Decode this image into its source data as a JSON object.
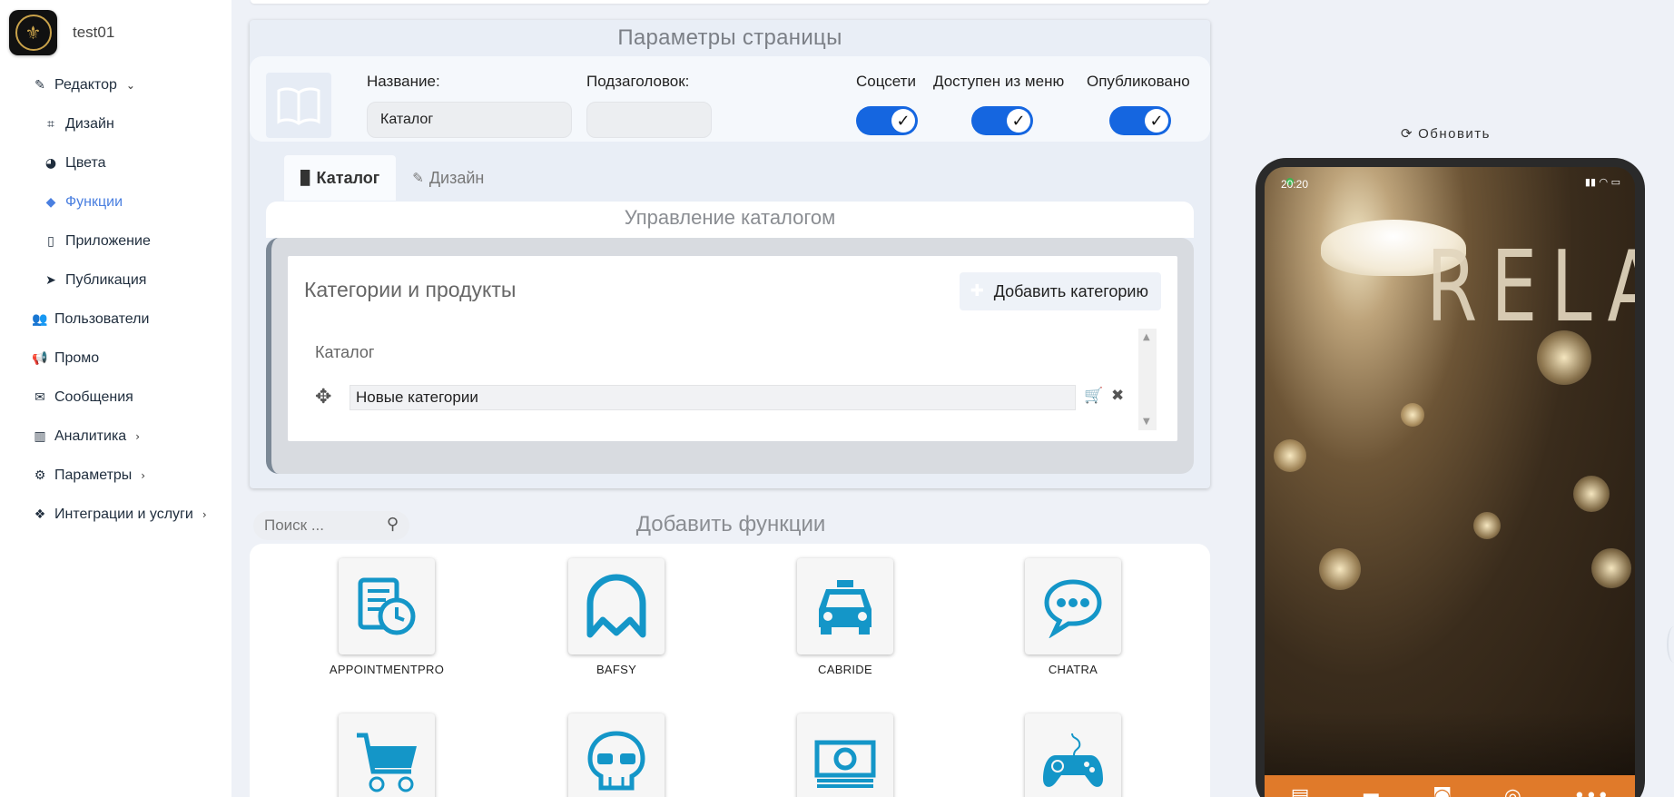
{
  "brand": {
    "name": "test01"
  },
  "sidebar": {
    "items": [
      {
        "label": "Редактор",
        "icon": "pencil-icon",
        "glyph": "✎",
        "chevron": "⌄"
      },
      {
        "label": "Дизайн",
        "icon": "crop-icon",
        "glyph": "⌗",
        "sub": true
      },
      {
        "label": "Цвета",
        "icon": "palette-icon",
        "glyph": "◕",
        "sub": true
      },
      {
        "label": "Функции",
        "icon": "cube-icon",
        "glyph": "◆",
        "sub": true,
        "active": true
      },
      {
        "label": "Приложение",
        "icon": "mobile-icon",
        "glyph": "▯",
        "sub": true
      },
      {
        "label": "Публикация",
        "icon": "paper-plane-icon",
        "glyph": "➤",
        "sub": true
      },
      {
        "label": "Пользователи",
        "icon": "users-icon",
        "glyph": "👥"
      },
      {
        "label": "Промо",
        "icon": "bullhorn-icon",
        "glyph": "📢"
      },
      {
        "label": "Сообщения",
        "icon": "envelope-icon",
        "glyph": "✉"
      },
      {
        "label": "Аналитика",
        "icon": "chart-icon",
        "glyph": "▥",
        "chevron": "›"
      },
      {
        "label": "Параметры",
        "icon": "cogs-icon",
        "glyph": "⚙",
        "chevron": "›"
      },
      {
        "label": "Интеграции и услуги",
        "icon": "cubes-icon",
        "glyph": "❖",
        "chevron": "›"
      }
    ]
  },
  "page_params": {
    "title": "Параметры страницы",
    "name_label": "Название:",
    "name_value": "Каталог",
    "subtitle_label": "Подзаголовок:",
    "subtitle_value": "",
    "toggles": [
      {
        "label": "Соцсети",
        "on": true
      },
      {
        "label": "Доступен из меню",
        "on": true
      },
      {
        "label": "Опубликовано",
        "on": true
      }
    ]
  },
  "tabs": [
    {
      "label": "Каталог",
      "icon": "book-icon",
      "glyph": "▉",
      "active": true
    },
    {
      "label": "Дизайн",
      "icon": "pencil-icon",
      "glyph": "✎",
      "active": false
    }
  ],
  "catalog": {
    "title": "Управление каталогом",
    "box_title": "Категории и продукты",
    "add_category": "Добавить категорию",
    "root": "Каталог",
    "categories": [
      {
        "name": "Новые категории"
      }
    ]
  },
  "functions": {
    "search_placeholder": "Поиск ...",
    "title": "Добавить функции",
    "items": [
      {
        "label": "APPOINTMENTPRO",
        "icon": "appointment-icon"
      },
      {
        "label": "BAFSY",
        "icon": "bafsy-icon"
      },
      {
        "label": "CABRIDE",
        "icon": "taxi-icon"
      },
      {
        "label": "CHATRA",
        "icon": "chat-icon"
      },
      {
        "label": "",
        "icon": "cart-icon"
      },
      {
        "label": "",
        "icon": "skull-icon"
      },
      {
        "label": "",
        "icon": "money-icon"
      },
      {
        "label": "",
        "icon": "gamepad-icon"
      }
    ]
  },
  "preview": {
    "refresh_label": "Обновить",
    "status_time": "20:20",
    "status_icons": "▮▮ ◠ ▭",
    "tabbar": [
      "▤",
      "▬",
      "◙",
      "◎",
      "•••"
    ]
  },
  "colors": {
    "accent": "#1566e0",
    "active_nav": "#4a7fe0",
    "func_icon": "#1496c8",
    "tabbar": "#e07a2a"
  }
}
